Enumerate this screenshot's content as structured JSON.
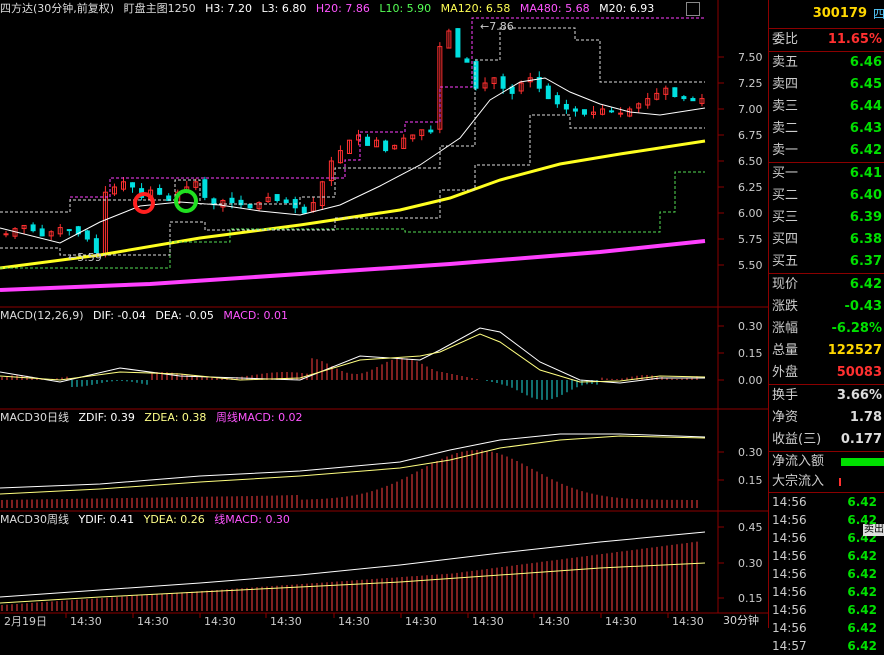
{
  "main_header": {
    "title": "四方达(30分钟,前复权)",
    "indicator": "盯盘主图1250",
    "h3": "H3: 7.20",
    "l3": "L3: 6.80",
    "h20": "H20: 7.86",
    "l10": "L10: 5.90",
    "ma120": "MA120: 6.58",
    "ma480": "MA480: 5.68",
    "m20": "M20: 6.93"
  },
  "macd_header": {
    "name": "MACD(12,26,9)",
    "dif": "DIF: -0.04",
    "dea": "DEA: -0.05",
    "macd": "MACD: 0.01"
  },
  "macd30d_header": {
    "name": "MACD30日线",
    "zdif": "ZDIF: 0.39",
    "zdea": "ZDEA: 0.38",
    "wmacd": "周线MACD: 0.02"
  },
  "macd30w_header": {
    "name": "MACD30周线",
    "ydif": "YDIF: 0.41",
    "ydea": "YDEA: 0.26",
    "macd": "线MACD: 0.30"
  },
  "price_axis": [
    "7.50",
    "7.25",
    "7.00",
    "6.75",
    "6.50",
    "6.25",
    "6.00",
    "5.75",
    "5.50"
  ],
  "macd_axis": [
    "0.30",
    "0.15",
    "0.00"
  ],
  "macd30d_axis": [
    "0.30",
    "0.15"
  ],
  "macd30w_axis": [
    "0.45",
    "0.30",
    "0.15"
  ],
  "annotations": {
    "high": "7.86",
    "low": "5.59"
  },
  "time_axis": [
    "2月19日",
    "14:30",
    "14:30",
    "14:30",
    "14:30",
    "14:30",
    "14:30",
    "14:30",
    "14:30",
    "14:30",
    "14:30"
  ],
  "period_label": "30分钟",
  "stock_code": "300179",
  "stock_code_suffix": "四",
  "quote": {
    "weibi_label": "委比",
    "weibi": "11.65%",
    "asks": [
      {
        "label": "卖五",
        "price": "6.46"
      },
      {
        "label": "卖四",
        "price": "6.45"
      },
      {
        "label": "卖三",
        "price": "6.44"
      },
      {
        "label": "卖二",
        "price": "6.43"
      },
      {
        "label": "卖一",
        "price": "6.42"
      }
    ],
    "bids": [
      {
        "label": "买一",
        "price": "6.41"
      },
      {
        "label": "买二",
        "price": "6.40"
      },
      {
        "label": "买三",
        "price": "6.39"
      },
      {
        "label": "买四",
        "price": "6.38"
      },
      {
        "label": "买五",
        "price": "6.37"
      }
    ],
    "stats": [
      {
        "label": "现价",
        "value": "6.42",
        "color": "#00e000"
      },
      {
        "label": "涨跌",
        "value": "-0.43",
        "color": "#00e000"
      },
      {
        "label": "涨幅",
        "value": "-6.28%",
        "color": "#00e000"
      },
      {
        "label": "总量",
        "value": "122527",
        "color": "#ffd700"
      },
      {
        "label": "外盘",
        "value": "50083",
        "color": "#ff3030"
      }
    ],
    "stats2": [
      {
        "label": "换手",
        "value": "3.66%",
        "color": "#ddd"
      },
      {
        "label": "净资",
        "value": "1.78",
        "color": "#ddd"
      },
      {
        "label": "收益(三)",
        "value": "0.177",
        "color": "#ddd"
      }
    ],
    "net_inflow_label": "净流入额",
    "big_inflow_label": "大宗流入",
    "ticks": [
      {
        "time": "14:56",
        "price": "6.42"
      },
      {
        "time": "14:56",
        "price": "6.42"
      },
      {
        "time": "14:56",
        "price": "6.42"
      },
      {
        "time": "14:56",
        "price": "6.42"
      },
      {
        "time": "14:56",
        "price": "6.42"
      },
      {
        "time": "14:56",
        "price": "6.42"
      },
      {
        "time": "14:56",
        "price": "6.42"
      },
      {
        "time": "14:56",
        "price": "6.42"
      },
      {
        "time": "14:57",
        "price": "6.42"
      }
    ],
    "side_tag": "卖出"
  }
}
